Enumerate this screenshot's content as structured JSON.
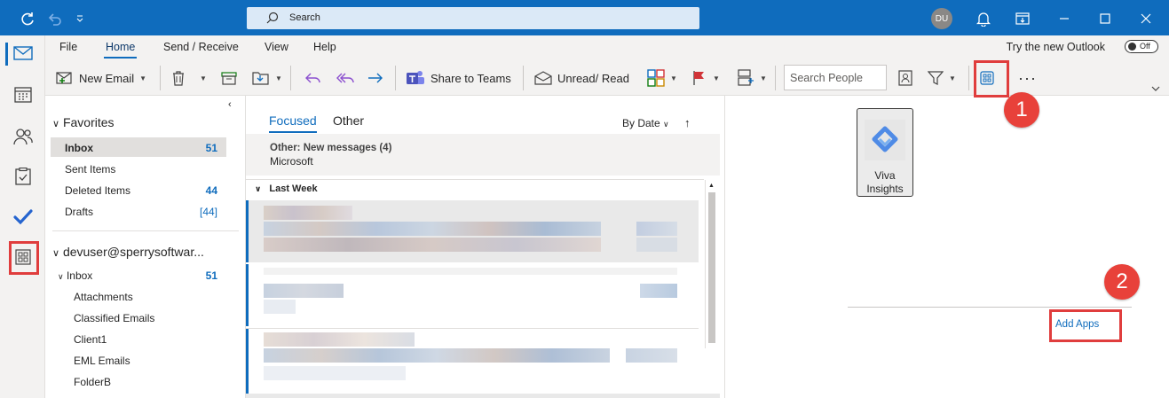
{
  "titlebar": {
    "search_placeholder": "Search",
    "avatar_initials": "DU"
  },
  "menu": {
    "tabs": [
      "File",
      "Home",
      "Send / Receive",
      "View",
      "Help"
    ],
    "active_tab": "Home",
    "try_new_label": "Try the new Outlook",
    "toggle_label": "Off"
  },
  "ribbon": {
    "new_email": "New Email",
    "share_to_teams": "Share to Teams",
    "unread_read": "Unread/ Read",
    "search_people_placeholder": "Search People",
    "more": "···"
  },
  "folders": {
    "favorites_label": "Favorites",
    "favorites": [
      {
        "label": "Inbox",
        "count": "51"
      },
      {
        "label": "Sent Items",
        "count": ""
      },
      {
        "label": "Deleted Items",
        "count": "44"
      },
      {
        "label": "Drafts",
        "count": "[44]"
      }
    ],
    "account_label": "devuser@sperrysoftwar...",
    "account_inbox": {
      "label": "Inbox",
      "count": "51"
    },
    "subfolders": [
      "Attachments",
      "Classified Emails",
      "Client1",
      "EML Emails",
      "FolderB"
    ]
  },
  "messages": {
    "tab_focused": "Focused",
    "tab_other": "Other",
    "sort_label": "By Date",
    "other_banner_title": "Other: New messages (4)",
    "other_banner_sender": "Microsoft",
    "group_label": "Last Week"
  },
  "apps": {
    "viva_label": "Viva Insights",
    "add_apps": "Add Apps"
  },
  "annotations": {
    "badge1": "1",
    "badge2": "2"
  },
  "colors": {
    "accent": "#0f6cbd",
    "highlight": "#e03d3d"
  }
}
